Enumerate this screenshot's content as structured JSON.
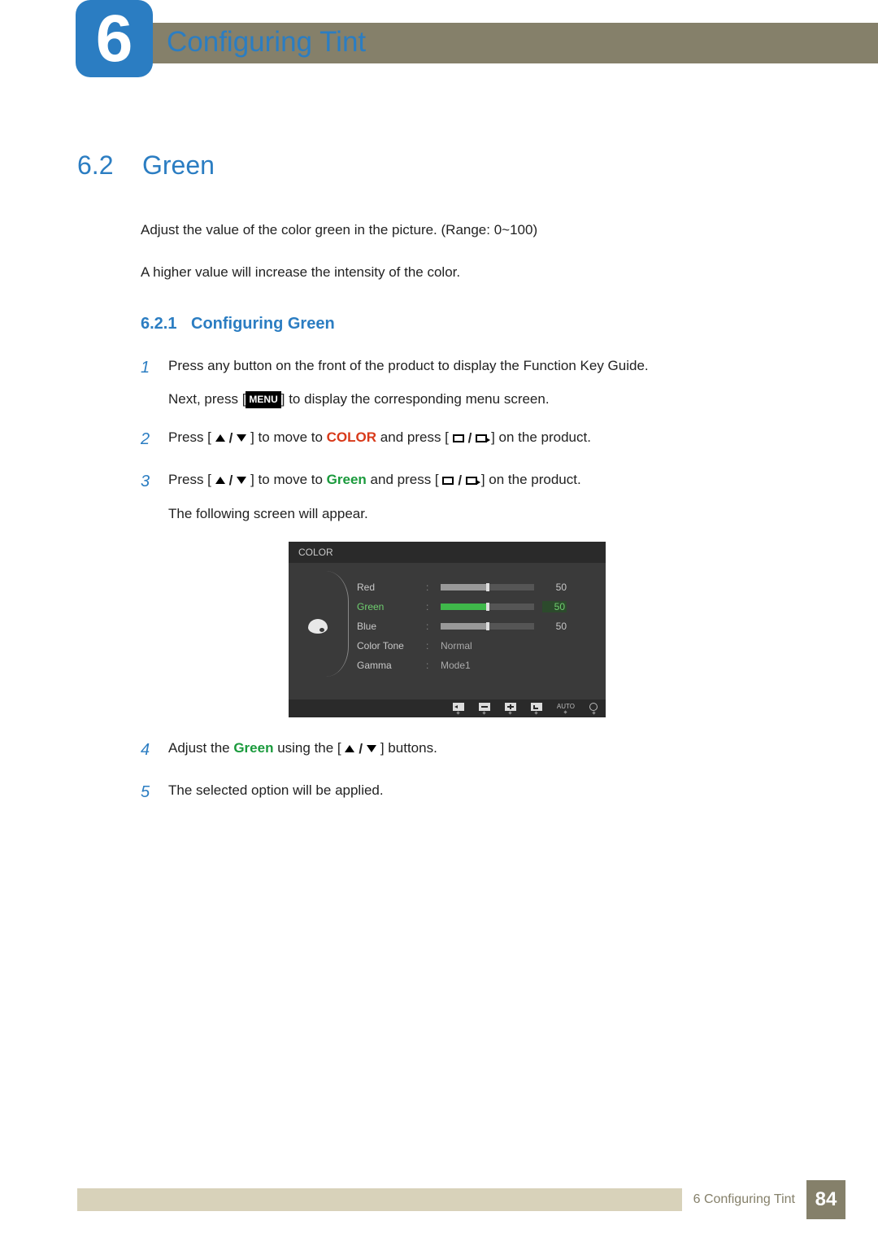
{
  "header": {
    "chapter_number": "6",
    "chapter_title": "Configuring Tint"
  },
  "section": {
    "number": "6.2",
    "title": "Green",
    "intro_line1": "Adjust the value of the color green in the picture. (Range: 0~100)",
    "intro_line2": "A higher value will increase the intensity of the color."
  },
  "subsection": {
    "number": "6.2.1",
    "title": "Configuring Green"
  },
  "steps": {
    "s1": {
      "num": "1",
      "line1": "Press any button on the front of the product to display the Function Key Guide.",
      "line2_a": "Next, press [",
      "menu_label": "MENU",
      "line2_b": "] to display the corresponding menu screen."
    },
    "s2": {
      "num": "2",
      "part_a": "Press [",
      "part_b": "] to move to ",
      "keyword": "COLOR",
      "part_c": " and press [",
      "part_d": "] on the product."
    },
    "s3": {
      "num": "3",
      "part_a": "Press [",
      "part_b": "] to move to ",
      "keyword": "Green",
      "part_c": " and press [",
      "part_d": "] on the product.",
      "line2": "The following screen will appear."
    },
    "s4": {
      "num": "4",
      "part_a": "Adjust the ",
      "keyword": "Green",
      "part_b": " using the [",
      "part_c": "] buttons."
    },
    "s5": {
      "num": "5",
      "text": "The selected option will be applied."
    }
  },
  "osd": {
    "title": "COLOR",
    "rows": [
      {
        "label": "Red",
        "value": "50",
        "fill": 50,
        "type": "slider",
        "active": false
      },
      {
        "label": "Green",
        "value": "50",
        "fill": 50,
        "type": "slider",
        "active": true
      },
      {
        "label": "Blue",
        "value": "50",
        "fill": 50,
        "type": "slider",
        "active": false
      },
      {
        "label": "Color Tone",
        "value": "Normal",
        "type": "text",
        "active": false
      },
      {
        "label": "Gamma",
        "value": "Mode1",
        "type": "text",
        "active": false
      }
    ],
    "footer_auto": "AUTO"
  },
  "footer": {
    "text": "6 Configuring Tint",
    "page": "84"
  }
}
